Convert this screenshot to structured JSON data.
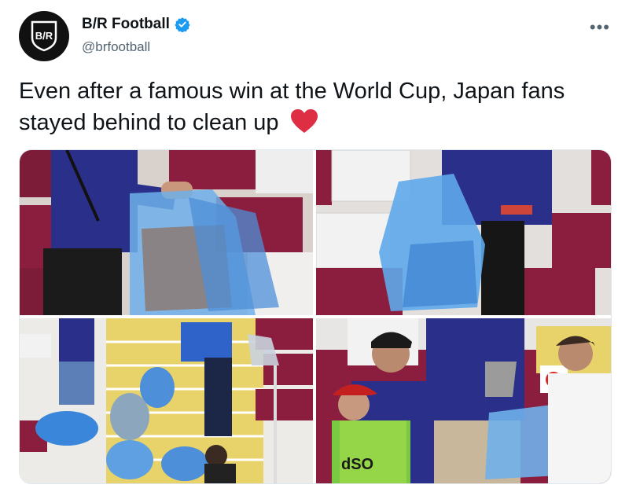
{
  "account": {
    "display_name": "B/R Football",
    "handle": "@brfootball",
    "logo_text": "B/R",
    "verified": true
  },
  "tweet": {
    "text": "Even after a famous win at the World Cup, Japan fans stayed behind to clean up",
    "emoji": "red-heart"
  },
  "media": {
    "photos": [
      {
        "label": "photo-1"
      },
      {
        "label": "photo-2"
      },
      {
        "label": "photo-3"
      },
      {
        "label": "photo-4"
      }
    ],
    "visible_text": {
      "vest_text": "dSO"
    }
  },
  "colors": {
    "seat_red": "#8b1e3f",
    "seat_white": "#f2f2f2",
    "japan_blue": "#27308f",
    "bag_blue": "#5aa7e6",
    "verified_blue": "#1d9bf0",
    "heart_red": "#e0245e"
  }
}
